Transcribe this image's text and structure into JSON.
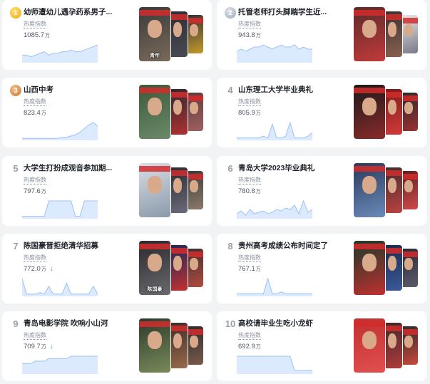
{
  "index_label": "热度指数",
  "unit": "万",
  "colors": {
    "accent": "#4f8ef7",
    "spark_fill": "#dceaff",
    "down": "#45b36b",
    "card": "#ffffff",
    "bg": "#f2f3f5"
  },
  "items": [
    {
      "rank": "1",
      "medal": "gold",
      "title": "幼师遭幼儿遇孕药系男子...",
      "value": "1085.7",
      "trend": "",
      "spark": [
        4,
        4,
        3,
        4,
        5,
        6,
        4,
        5,
        5,
        6,
        6,
        7,
        6,
        6,
        7,
        8,
        9,
        10
      ],
      "thumbs": [
        {
          "colors": [
            "#3a3a3a",
            "#7a6a5a"
          ],
          "caption": "青年"
        },
        {
          "colors": [
            "#2c2c34",
            "#4a4a55"
          ],
          "caption": ""
        },
        {
          "colors": [
            "#2a2f3a",
            "#c59a2a"
          ],
          "caption": ""
        }
      ]
    },
    {
      "rank": "2",
      "medal": "silver",
      "title": "托管老师打头脚踹学生近...",
      "value": "943.8",
      "trend": "",
      "spark": [
        5,
        6,
        5,
        6,
        7,
        7,
        8,
        7,
        6,
        7,
        8,
        7,
        7,
        8,
        6,
        7,
        6,
        6
      ],
      "thumbs": [
        {
          "colors": [
            "#5a2a2a",
            "#c23a3a"
          ],
          "caption": ""
        },
        {
          "colors": [
            "#3a3030",
            "#8a6050"
          ],
          "caption": ""
        },
        {
          "colors": [
            "#e8e8ea",
            "#7a7a88"
          ],
          "caption": ""
        }
      ]
    },
    {
      "rank": "3",
      "medal": "bronze",
      "title": "山西中考",
      "value": "823.4",
      "trend": "",
      "spark": [
        1,
        1,
        1,
        1,
        1,
        1,
        1,
        1,
        1,
        2,
        2,
        3,
        4,
        6,
        9,
        12,
        14,
        11
      ],
      "thumbs": [
        {
          "colors": [
            "#3d5a3a",
            "#6a8a6a"
          ],
          "caption": ""
        },
        {
          "colors": [
            "#2a2a30",
            "#b03030"
          ],
          "caption": ""
        },
        {
          "colors": [
            "#5a3a3a",
            "#a06060"
          ],
          "caption": ""
        }
      ]
    },
    {
      "rank": "4",
      "medal": "",
      "title": "山东理工大学毕业典礼",
      "value": "805.9",
      "trend": "",
      "spark": [
        1,
        1,
        1,
        1,
        1,
        1,
        2,
        1,
        9,
        1,
        1,
        2,
        10,
        1,
        1,
        1,
        2,
        4
      ],
      "thumbs": [
        {
          "colors": [
            "#1a1a1a",
            "#8a2a2a"
          ],
          "caption": ""
        },
        {
          "colors": [
            "#7a1a1a",
            "#d33a3a"
          ],
          "caption": ""
        },
        {
          "colors": [
            "#2a2a2a",
            "#9a3030"
          ],
          "caption": ""
        }
      ]
    },
    {
      "rank": "5",
      "medal": "",
      "title": "大学生打扮成观音参加期...",
      "value": "797.6",
      "trend": "",
      "spark": [
        1,
        1,
        1,
        1,
        1,
        1,
        10,
        10,
        10,
        10,
        10,
        10,
        1,
        1,
        10,
        10,
        10,
        10
      ],
      "thumbs": [
        {
          "colors": [
            "#d8dde5",
            "#8a9aaa"
          ],
          "caption": ""
        },
        {
          "colors": [
            "#2a2a30",
            "#6a6a7a"
          ],
          "caption": ""
        },
        {
          "colors": [
            "#3a3a3a",
            "#8a7a6a"
          ],
          "caption": ""
        }
      ]
    },
    {
      "rank": "6",
      "medal": "",
      "title": "青岛大学2023毕业典礼",
      "value": "780.8",
      "trend": "",
      "spark": [
        3,
        5,
        2,
        6,
        3,
        4,
        5,
        3,
        4,
        6,
        5,
        7,
        6,
        9,
        3,
        12,
        4,
        6
      ],
      "thumbs": [
        {
          "colors": [
            "#2a3a5a",
            "#6a8aba"
          ],
          "caption": ""
        },
        {
          "colors": [
            "#3a3030",
            "#c04040"
          ],
          "caption": ""
        },
        {
          "colors": [
            "#5a2020",
            "#d04a4a"
          ],
          "caption": ""
        }
      ]
    },
    {
      "rank": "7",
      "medal": "",
      "title": "陈国豪晋拒绝清华招募",
      "value": "772.0",
      "trend": "↓",
      "spark": [
        11,
        1,
        1,
        1,
        2,
        1,
        6,
        1,
        1,
        1,
        8,
        1,
        1,
        1,
        1,
        1,
        6,
        1
      ],
      "thumbs": [
        {
          "colors": [
            "#2a2a2e",
            "#6a6a6e"
          ],
          "caption": "陈国豪"
        },
        {
          "colors": [
            "#1a2a5a",
            "#c43030"
          ],
          "caption": ""
        },
        {
          "colors": [
            "#3a3030",
            "#b04a40"
          ],
          "caption": ""
        }
      ]
    },
    {
      "rank": "8",
      "medal": "",
      "title": "贵州高考成绩公布时间定了",
      "value": "767.1",
      "trend": "",
      "spark": [
        1,
        1,
        1,
        1,
        1,
        1,
        1,
        9,
        1,
        1,
        2,
        1,
        1,
        1,
        1,
        1,
        1,
        1
      ],
      "thumbs": [
        {
          "colors": [
            "#1a3a2a",
            "#c03030"
          ],
          "caption": ""
        },
        {
          "colors": [
            "#1a2a4a",
            "#3a5a9a"
          ],
          "caption": ""
        },
        {
          "colors": [
            "#2a2a35",
            "#5a5a6a"
          ],
          "caption": ""
        }
      ]
    },
    {
      "rank": "9",
      "medal": "",
      "title": "青岛电影学院 吹响小山河",
      "value": "709.7",
      "trend": "↓",
      "spark": [
        4,
        4,
        4,
        5,
        5,
        5,
        6,
        6,
        6,
        6,
        6,
        7,
        7,
        7,
        7,
        7,
        7,
        7
      ],
      "thumbs": [
        {
          "colors": [
            "#2a3a2a",
            "#7a8a5a"
          ],
          "caption": ""
        },
        {
          "colors": [
            "#3a2a2a",
            "#9a6a4a"
          ],
          "caption": ""
        },
        {
          "colors": [
            "#2a2a2a",
            "#7a5a4a"
          ],
          "caption": ""
        }
      ]
    },
    {
      "rank": "10",
      "medal": "",
      "title": "高校请毕业生吃小龙虾",
      "value": "692.9",
      "trend": "",
      "spark": [
        12,
        12,
        12,
        12,
        12,
        12,
        12,
        12,
        12,
        12,
        12,
        12,
        12,
        2,
        2,
        2,
        2,
        2
      ],
      "thumbs": [
        {
          "colors": [
            "#c03030",
            "#e25050"
          ],
          "caption": ""
        },
        {
          "colors": [
            "#3a2a2a",
            "#b03a3a"
          ],
          "caption": ""
        },
        {
          "colors": [
            "#2a2a2a",
            "#c84a3a"
          ],
          "caption": ""
        }
      ]
    }
  ]
}
